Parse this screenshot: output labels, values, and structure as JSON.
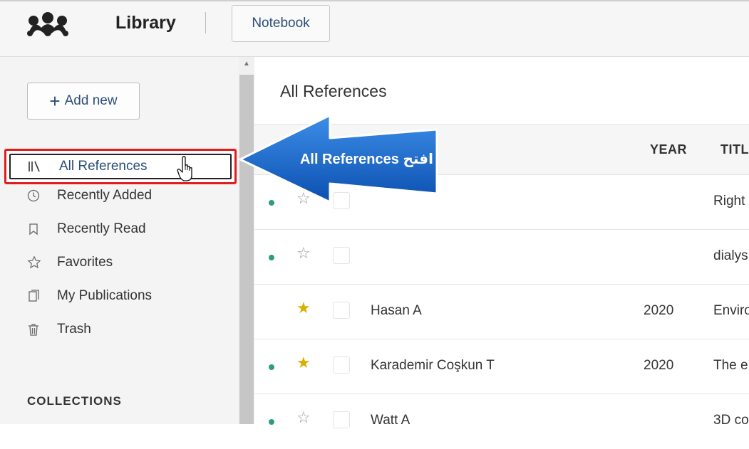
{
  "topbar": {
    "app_title": "Library",
    "notebook_label": "Notebook"
  },
  "sidebar": {
    "add_new_label": "Add new",
    "items": [
      {
        "label": "All References",
        "icon": "library-icon",
        "selected": true
      },
      {
        "label": "Recently Added",
        "icon": "clock-icon"
      },
      {
        "label": "Recently Read",
        "icon": "bookmark-icon"
      },
      {
        "label": "Favorites",
        "icon": "star-outline-icon"
      },
      {
        "label": "My Publications",
        "icon": "publications-icon"
      },
      {
        "label": "Trash",
        "icon": "trash-icon"
      }
    ],
    "collections_heading": "COLLECTIONS"
  },
  "main": {
    "title": "All References",
    "columns": {
      "year": "YEAR",
      "title": "TITL"
    },
    "rows": [
      {
        "unread": true,
        "favorite": false,
        "author": "",
        "year": "",
        "title": "Right"
      },
      {
        "unread": true,
        "favorite": false,
        "author": "",
        "year": "",
        "title": "dialys"
      },
      {
        "unread": false,
        "favorite": true,
        "author": "Hasan A",
        "year": "2020",
        "title": "Enviro"
      },
      {
        "unread": true,
        "favorite": true,
        "author": "Karademir Coşkun T",
        "year": "2020",
        "title": "The e"
      },
      {
        "unread": true,
        "favorite": false,
        "author": "Watt A",
        "year": "",
        "title": "3D co"
      }
    ]
  },
  "callout": {
    "text": "افتح  All References",
    "color": "#1565c8"
  },
  "colors": {
    "accent_text": "#2b4e78",
    "unread_dot": "#2f9c82",
    "favorite_star": "#d7b000",
    "highlight_border": "#e11c1c"
  }
}
